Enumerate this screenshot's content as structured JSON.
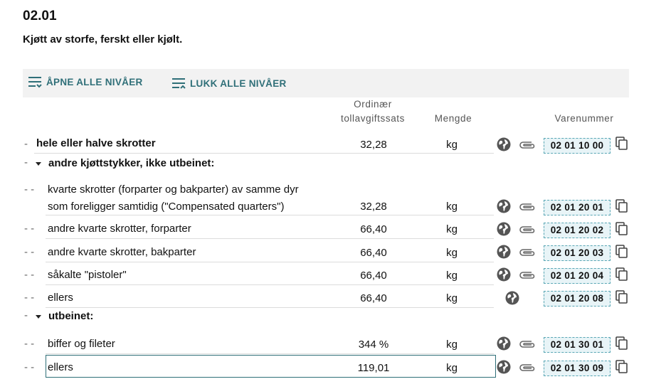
{
  "heading": "02.01",
  "subheading": "Kjøtt av storfe, ferskt eller kjølt.",
  "toolbar": {
    "open_all_label": "ÅPNE ALLE NIVÅER",
    "close_all_label": "LUKK ALLE NIVÅER"
  },
  "columns": {
    "rate_line1": "Ordinær",
    "rate_line2": "tollavgiftssats",
    "unit": "Mengde",
    "code": "Varenummer"
  },
  "icons": {
    "globe": "globe-icon",
    "clip": "paperclip-icon",
    "copy": "copy-icon",
    "lines": "list-lines-icon",
    "caret": "caret-down-icon"
  },
  "rows": [
    {
      "dash": "-",
      "desc": "hele eller halve skrotter",
      "rate": "32,28",
      "unit": "kg",
      "code": "02 01 10 00"
    },
    {
      "dash": "-",
      "group": "andre kjøttstykker, ikke utbeinet:"
    },
    {
      "dash": "- -",
      "desc_line1": "kvarte skrotter (forparter og bakparter) av samme dyr",
      "desc": "som foreligger samtidig (\"Compensated quarters\")",
      "rate": "32,28",
      "unit": "kg",
      "code": "02 01 20 01"
    },
    {
      "dash": "- -",
      "desc": "andre kvarte skrotter, forparter",
      "rate": "66,40",
      "unit": "kg",
      "code": "02 01 20 02"
    },
    {
      "dash": "- -",
      "desc": "andre kvarte skrotter, bakparter",
      "rate": "66,40",
      "unit": "kg",
      "code": "02 01 20 03"
    },
    {
      "dash": "- -",
      "desc": "såkalte \"pistoler\"",
      "rate": "66,40",
      "unit": "kg",
      "code": "02 01 20 04"
    },
    {
      "dash": "- -",
      "desc": "ellers",
      "rate": "66,40",
      "unit": "kg",
      "code": "02 01 20 08"
    },
    {
      "dash": "-",
      "group": "utbeinet:"
    },
    {
      "dash": "- -",
      "desc": "biffer og fileter",
      "rate": "344 %",
      "unit": "kg",
      "code": "02 01 30 01"
    },
    {
      "dash": "- -",
      "desc": "ellers",
      "rate": "119,01",
      "unit": "kg",
      "code": "02 01 30 09"
    }
  ]
}
